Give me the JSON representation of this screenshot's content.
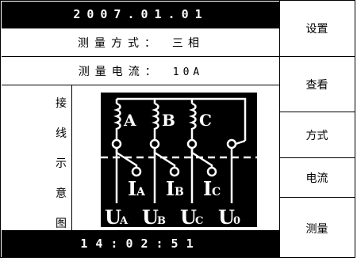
{
  "header": {
    "date": "2007.01.01"
  },
  "info": {
    "mode_label": "测量方式：",
    "mode_value": "三相",
    "current_label": "测量电流：",
    "current_value": "10A"
  },
  "diagram": {
    "vertical_label": [
      "接",
      "线",
      "示",
      "意",
      "图"
    ],
    "phase_labels": [
      "A",
      "B",
      "C"
    ],
    "current_labels": [
      "I",
      "I",
      "I"
    ],
    "current_subscripts": [
      "A",
      "B",
      "C"
    ],
    "voltage_labels": [
      "U",
      "U",
      "U",
      "U"
    ],
    "voltage_subscripts": [
      "A",
      "B",
      "C",
      "0"
    ]
  },
  "footer": {
    "time": "14:02:51"
  },
  "menu": {
    "settings": "设置",
    "view": "查看",
    "mode": "方式",
    "current": "电流",
    "measure": "测量"
  }
}
